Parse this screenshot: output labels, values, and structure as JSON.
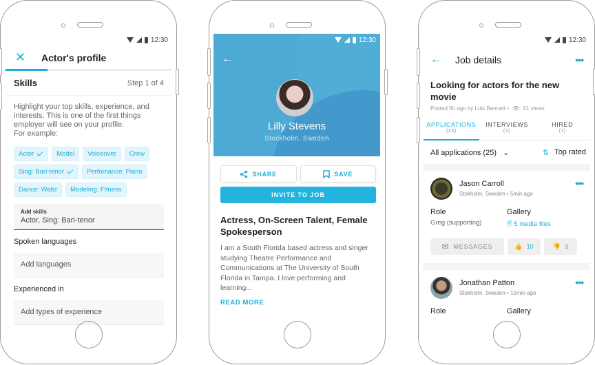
{
  "status_bar": {
    "time": "12:30"
  },
  "profile_editor": {
    "title": "Actor's profile",
    "close_icon": "close-icon",
    "progress": 0.25,
    "section": "Skills",
    "step": "Step 1 of 4",
    "intro": "Highlight your top skills, experience, and interests. This is one of the first things employer will see on your profile.\nFor example:",
    "chips": [
      {
        "label": "Actor",
        "selected": true
      },
      {
        "label": "Model",
        "selected": false
      },
      {
        "label": "Voiceover",
        "selected": false
      },
      {
        "label": "Crew",
        "selected": false
      },
      {
        "label": "Sing: Bari-tenor",
        "selected": true
      },
      {
        "label": "Perfomance: Piano",
        "selected": false
      },
      {
        "label": "Dance: Waltz",
        "selected": false
      },
      {
        "label": "Modeling: Fitness",
        "selected": false
      }
    ],
    "skills_field": {
      "label": "Add skills",
      "value": "Actor, Sing: Bari-tenor"
    },
    "languages_heading": "Spoken languages",
    "languages_placeholder": "Add languages",
    "experience_heading": "Experienced in",
    "experience_placeholder": "Add types of experience"
  },
  "actor_profile": {
    "name": "Lilly Stevens",
    "location": "Stockholm, Sweden",
    "share_label": "SHARE",
    "save_label": "SAVE",
    "invite_label": "INVITE TO JOB",
    "headline": "Actress, On-Screen Talent, Female Spokesperson",
    "bio": "I am a South Florida based actress and singer studying Theatre Performance and Communications at The University of South Florida in Tampa. I love performing and learning...",
    "read_more": "READ MORE"
  },
  "job_details": {
    "title": "Job details",
    "job_title": "Looking for actors for the new movie",
    "posted": "Posted 5h ago by Luis Bennett •",
    "views": "51 views",
    "tabs": [
      {
        "label": "APPLICATIONS",
        "count": "(22)",
        "active": true
      },
      {
        "label": "INTERVIEWS",
        "count": "(3)",
        "active": false
      },
      {
        "label": "HIRED",
        "count": "(1)",
        "active": false
      }
    ],
    "filter_label": "All applications (25)",
    "sort_label": "Top rated",
    "applicants": [
      {
        "name": "Jason Carroll",
        "meta": "Stokholm, Sweden • 5min ago",
        "role_label": "Role",
        "role": "Greg (supporting)",
        "gallery_label": "Gallery",
        "gallery": "5 media files",
        "messages_label": "MESSAGES",
        "likes": "10",
        "dislikes": "3"
      },
      {
        "name": "Jonathan Patton",
        "meta": "Stokholm, Sweden • 15min ago",
        "role_label": "Role",
        "gallery_label": "Gallery"
      }
    ]
  }
}
